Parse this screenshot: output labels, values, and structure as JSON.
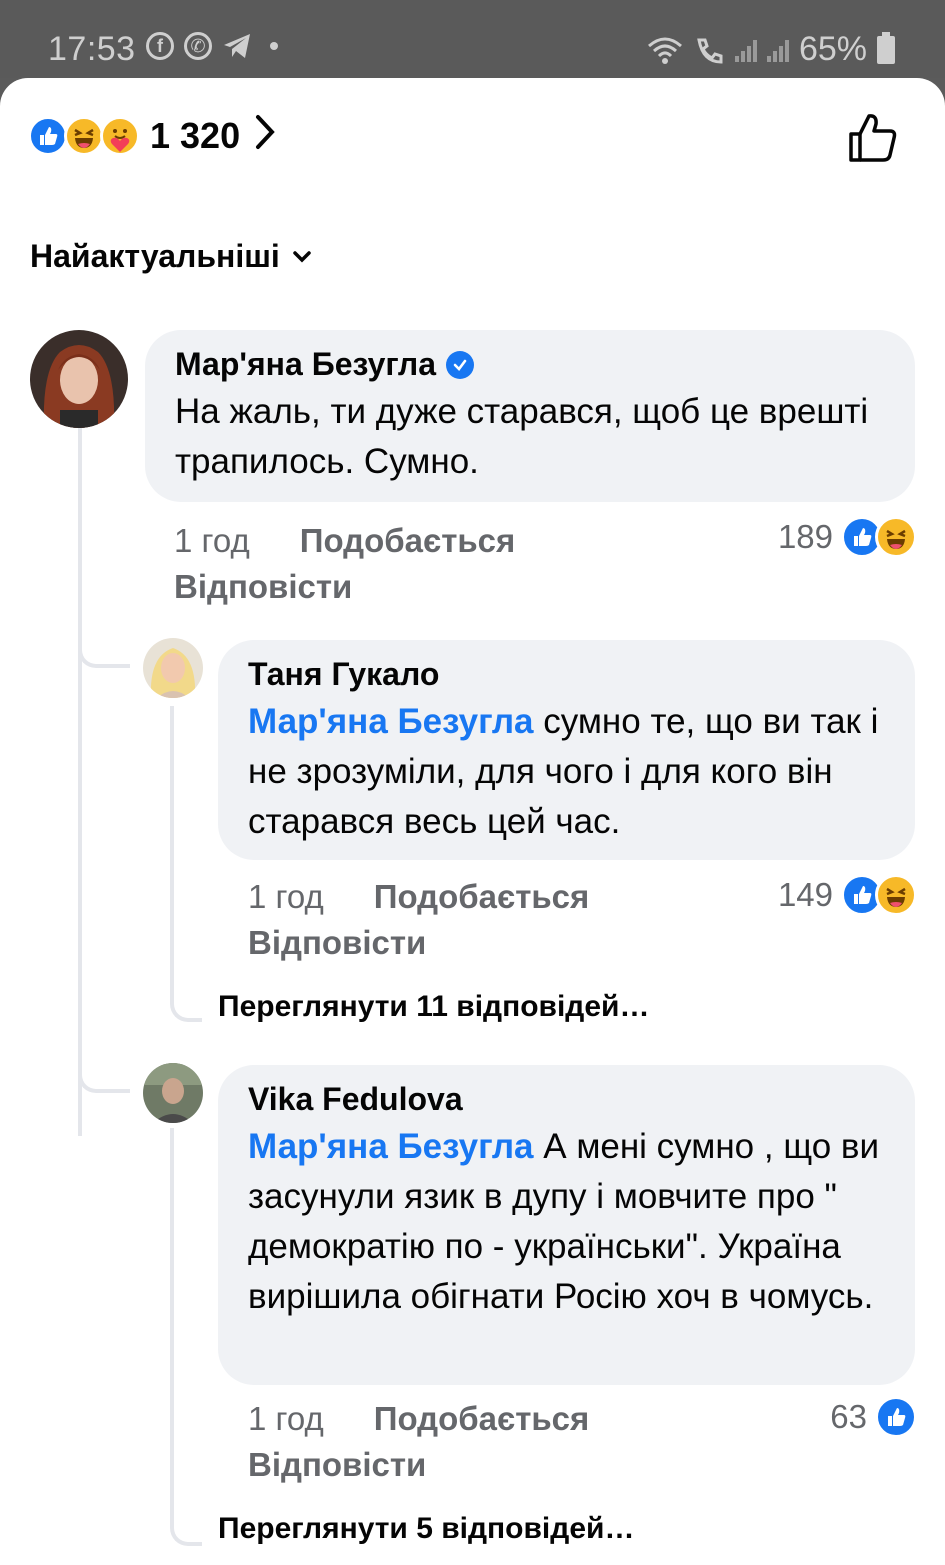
{
  "status_bar": {
    "time": "17:53",
    "battery": "65%",
    "app_icons": [
      "facebook-icon",
      "whatsapp-icon",
      "telegram-icon"
    ]
  },
  "reactions": {
    "count": "1 320",
    "types": [
      "like",
      "haha",
      "care"
    ]
  },
  "sort": {
    "label": "Найактуальніші"
  },
  "comments": [
    {
      "author": "Мар'яна Безугла",
      "verified": true,
      "text": "На жаль, ти дуже старався, щоб це врешті трапилось. Сумно.",
      "time": "1 год",
      "like_label": "Подобається",
      "reply_label": "Відповісти",
      "reaction_count": "189"
    },
    {
      "author": "Таня Гукало",
      "mention": "Мар'яна Безугла",
      "text": " сумно те, що ви так і не зрозуміли, для чого і для кого він старався весь цей час.",
      "time": "1 год",
      "like_label": "Подобається",
      "reply_label": "Відповісти",
      "reaction_count": "149",
      "view_replies": "Переглянути 11 відповідей…"
    },
    {
      "author": "Vika Fedulova",
      "mention": "Мар'яна Безугла",
      "text": " А мені сумно , що ви засунули язик в дупу і мовчите про \" демократію по - українськи\".  Україна вирішила обігнати Росію хоч в чомусь.",
      "time": "1 год",
      "like_label": "Подобається",
      "reply_label": "Відповісти",
      "reaction_count": "63",
      "view_replies": "Переглянути 5 відповідей…"
    }
  ],
  "colors": {
    "accent": "#1877f2",
    "bubble": "#f0f2f5",
    "meta": "#65676b"
  }
}
